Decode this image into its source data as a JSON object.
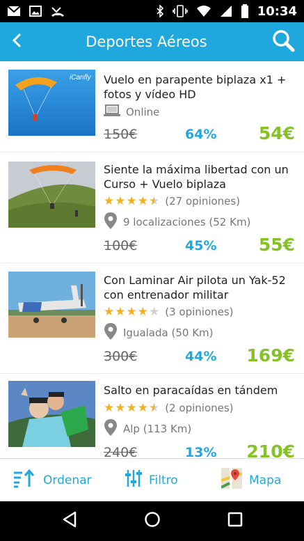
{
  "status_bar": {
    "time": "10:34",
    "left_icons": [
      "gmail-icon",
      "image-icon",
      "missed-call-icon"
    ],
    "right_icons": [
      "bluetooth-icon",
      "vibrate-icon",
      "wifi-icon",
      "signal-icon",
      "battery-icon"
    ]
  },
  "app_bar": {
    "title": "Deportes Aéreos",
    "back_icon": "back-arrow-icon",
    "search_icon": "search-icon",
    "color": "#1ea8de"
  },
  "deals": [
    {
      "title": "Vuelo en parapente biplaza x1 + fotos y vídeo HD",
      "image": "paraglider-sky-photo",
      "image_text": "iCanfly",
      "meta_icon": "laptop-icon",
      "meta_text": "Online",
      "old_price": "150€",
      "discount": "64%",
      "price": "54€"
    },
    {
      "title": "Siente la máxima libertad con un Curso + Vuelo biplaza",
      "image": "paraglider-mountain-photo",
      "rating": 4.5,
      "opinions": "(27 opiniones)",
      "location_icon": "location-pin-icon",
      "location": "9 localizaciones (52 Km)",
      "old_price": "100€",
      "discount": "45%",
      "price": "55€"
    },
    {
      "title": "Con Laminar Air pilota un Yak-52 con entrenador militar",
      "image": "yak52-aircraft-photo",
      "rating": 4,
      "opinions": "(3 opiniones)",
      "location_icon": "location-pin-icon",
      "location": "Igualada (50 Km)",
      "old_price": "300€",
      "discount": "44%",
      "price": "169€"
    },
    {
      "title": "Salto en paracaídas en tándem",
      "image": "tandem-skydive-photo",
      "rating": 4.5,
      "opinions": "(2 opiniones)",
      "location_icon": "location-pin-icon",
      "location": "Alp (113 Km)",
      "old_price": "240€",
      "discount": "13%",
      "price": "210€"
    }
  ],
  "actions": {
    "order": "Ordenar",
    "filter": "Filtro",
    "map": "Mapa"
  },
  "colors": {
    "accent": "#1ea8de",
    "price": "#84c225",
    "star": "#f5b021"
  }
}
